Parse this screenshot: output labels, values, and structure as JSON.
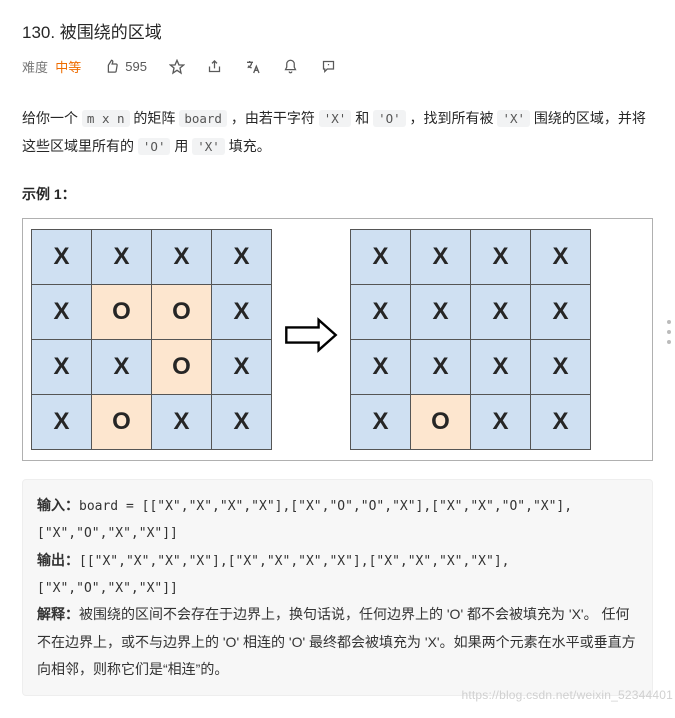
{
  "title": "130. 被围绕的区域",
  "difficulty_label": "难度",
  "difficulty_value": "中等",
  "likes": "595",
  "icons": {
    "thumb": "thumb-up-icon",
    "star": "star-icon",
    "share": "share-icon",
    "translate": "translate-icon",
    "bell": "bell-icon",
    "feedback": "feedback-icon"
  },
  "description": {
    "p1a": "给你一个 ",
    "c1": "m x n",
    "p1b": " 的矩阵 ",
    "c2": "board",
    "p1c": " ，由若干字符 ",
    "c3": "'X'",
    "p1d": " 和 ",
    "c4": "'O'",
    "p1e": " ，找到所有被 ",
    "c5": "'X'",
    "p1f": " 围绕的区域，并将这些区域里所有的 ",
    "c6": "'O'",
    "p1g": " 用 ",
    "c7": "'X'",
    "p1h": " 填充。"
  },
  "example_heading": "示例 1：",
  "grid_left": [
    [
      "X",
      "X",
      "X",
      "X"
    ],
    [
      "X",
      "O",
      "O",
      "X"
    ],
    [
      "X",
      "X",
      "O",
      "X"
    ],
    [
      "X",
      "O",
      "X",
      "X"
    ]
  ],
  "grid_right": [
    [
      "X",
      "X",
      "X",
      "X"
    ],
    [
      "X",
      "X",
      "X",
      "X"
    ],
    [
      "X",
      "X",
      "X",
      "X"
    ],
    [
      "X",
      "O",
      "X",
      "X"
    ]
  ],
  "io": {
    "in_label": "输入：",
    "in_code": "board = [[\"X\",\"X\",\"X\",\"X\"],[\"X\",\"O\",\"O\",\"X\"],[\"X\",\"X\",\"O\",\"X\"],[\"X\",\"O\",\"X\",\"X\"]]",
    "out_label": "输出：",
    "out_code": "[[\"X\",\"X\",\"X\",\"X\"],[\"X\",\"X\",\"X\",\"X\"],[\"X\",\"X\",\"X\",\"X\"],[\"X\",\"O\",\"X\",\"X\"]]",
    "exp_label": "解释：",
    "exp_text": "被围绕的区间不会存在于边界上，换句话说，任何边界上的 'O' 都不会被填充为 'X'。 任何不在边界上，或不与边界上的 'O' 相连的 'O' 最终都会被填充为 'X'。如果两个元素在水平或垂直方向相邻，则称它们是“相连”的。"
  },
  "watermark": "https://blog.csdn.net/weixin_52344401"
}
